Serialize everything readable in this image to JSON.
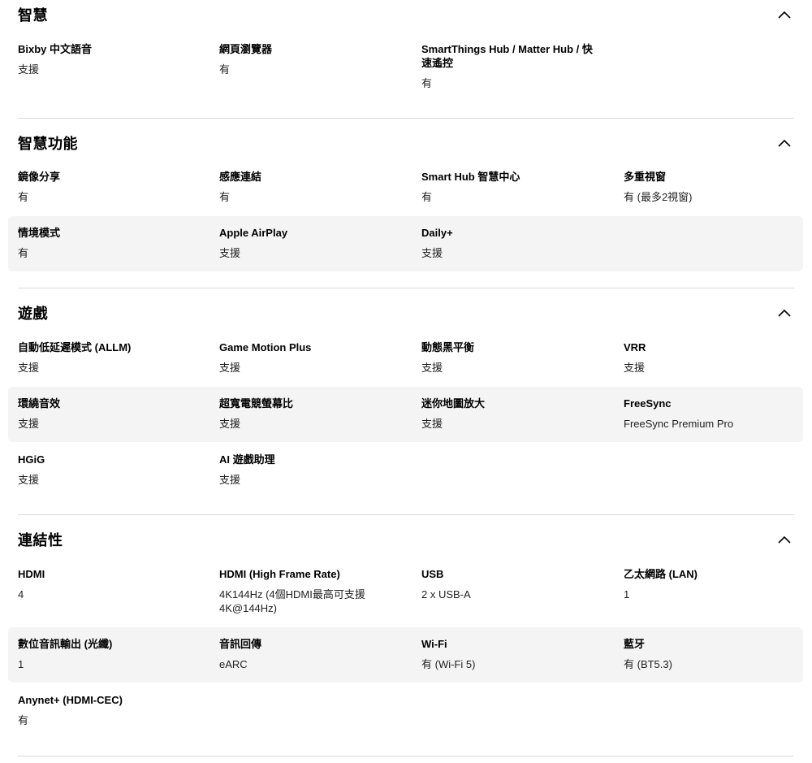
{
  "sections": [
    {
      "title": "智慧",
      "rows": [
        {
          "shaded": false,
          "cells": [
            {
              "label": "Bixby 中文語音",
              "value": "支援"
            },
            {
              "label": "網頁瀏覽器",
              "value": "有"
            },
            {
              "label": "SmartThings Hub / Matter Hub / 快速遙控",
              "value": "有"
            }
          ]
        }
      ]
    },
    {
      "title": "智慧功能",
      "rows": [
        {
          "shaded": false,
          "cells": [
            {
              "label": "鏡像分享",
              "value": "有"
            },
            {
              "label": "感應連結",
              "value": "有"
            },
            {
              "label": "Smart Hub 智慧中心",
              "value": "有"
            },
            {
              "label": "多重視窗",
              "value": "有 (最多2視窗)"
            }
          ]
        },
        {
          "shaded": true,
          "cells": [
            {
              "label": "情境模式",
              "value": "有"
            },
            {
              "label": "Apple AirPlay",
              "value": "支援"
            },
            {
              "label": "Daily+",
              "value": "支援"
            }
          ]
        }
      ]
    },
    {
      "title": "遊戲",
      "rows": [
        {
          "shaded": false,
          "cells": [
            {
              "label": "自動低延遲模式 (ALLM)",
              "value": "支援"
            },
            {
              "label": "Game Motion Plus",
              "value": "支援"
            },
            {
              "label": "動態黑平衡",
              "value": "支援"
            },
            {
              "label": "VRR",
              "value": "支援"
            }
          ]
        },
        {
          "shaded": true,
          "cells": [
            {
              "label": "環繞音效",
              "value": "支援"
            },
            {
              "label": "超寬電競螢幕比",
              "value": "支援"
            },
            {
              "label": "迷你地圖放大",
              "value": "支援"
            },
            {
              "label": "FreeSync",
              "value": "FreeSync Premium Pro"
            }
          ]
        },
        {
          "shaded": false,
          "cells": [
            {
              "label": "HGiG",
              "value": "支援"
            },
            {
              "label": "AI 遊戲助理",
              "value": "支援"
            }
          ]
        }
      ]
    },
    {
      "title": "連結性",
      "rows": [
        {
          "shaded": false,
          "cells": [
            {
              "label": "HDMI",
              "value": "4"
            },
            {
              "label": "HDMI (High Frame Rate)",
              "value": "4K144Hz (4個HDMI最高可支援4K@144Hz)"
            },
            {
              "label": "USB",
              "value": "2 x USB-A"
            },
            {
              "label": "乙太網路 (LAN)",
              "value": "1"
            }
          ]
        },
        {
          "shaded": true,
          "cells": [
            {
              "label": "數位音訊輸出 (光纖)",
              "value": "1"
            },
            {
              "label": "音訊回傳",
              "value": "eARC"
            },
            {
              "label": "Wi-Fi",
              "value": "有 (Wi-Fi 5)"
            },
            {
              "label": "藍牙",
              "value": "有 (BT5.3)"
            }
          ]
        },
        {
          "shaded": false,
          "cells": [
            {
              "label": "Anynet+ (HDMI-CEC)",
              "value": "有"
            }
          ]
        }
      ]
    }
  ]
}
